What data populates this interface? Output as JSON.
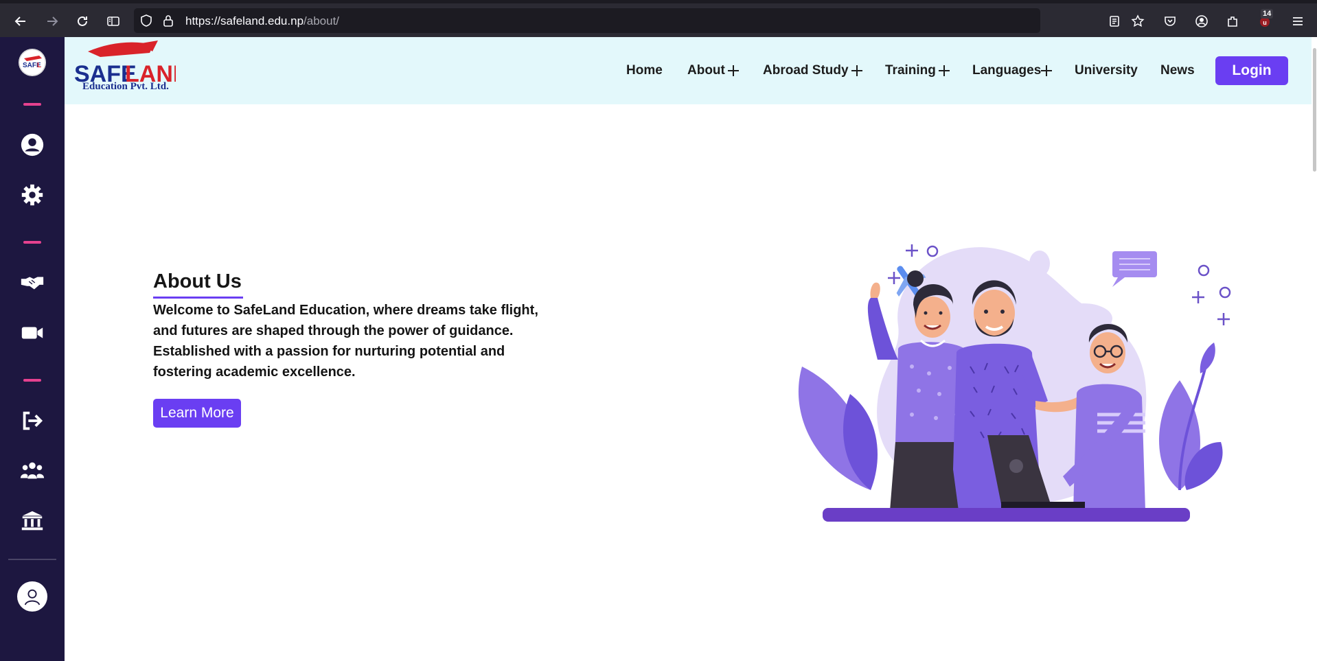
{
  "browser": {
    "url_host": "https://safeland.edu.np",
    "url_path": "/about/",
    "extension_badge": "14"
  },
  "header": {
    "logo_sub": "Education Pvt. Ltd.",
    "logo_brand": "SAFELAND",
    "nav": [
      {
        "label": "Home"
      },
      {
        "label": "About"
      },
      {
        "label": "Abroad Study"
      },
      {
        "label": "Training"
      },
      {
        "label": "Languages"
      },
      {
        "label": "University"
      },
      {
        "label": "News"
      }
    ],
    "login_label": "Login"
  },
  "main": {
    "title": "About Us",
    "paragraph": "Welcome to SafeLand Education, where dreams take flight, and futures are shaped through the power of guidance. Established with a passion for nurturing potential and fostering academic excellence.",
    "button_label": "Learn More"
  },
  "sidebar": {
    "icons": [
      "profile-icon",
      "gear-icon",
      "handshake-icon",
      "video-icon",
      "logout-icon",
      "group-icon",
      "bank-icon",
      "avatar-icon"
    ]
  },
  "colors": {
    "accent": "#6a3ef2",
    "sidebar_bg": "#1d1740",
    "topbar_bg": "#e3f8fb",
    "dash": "#e5418f"
  }
}
